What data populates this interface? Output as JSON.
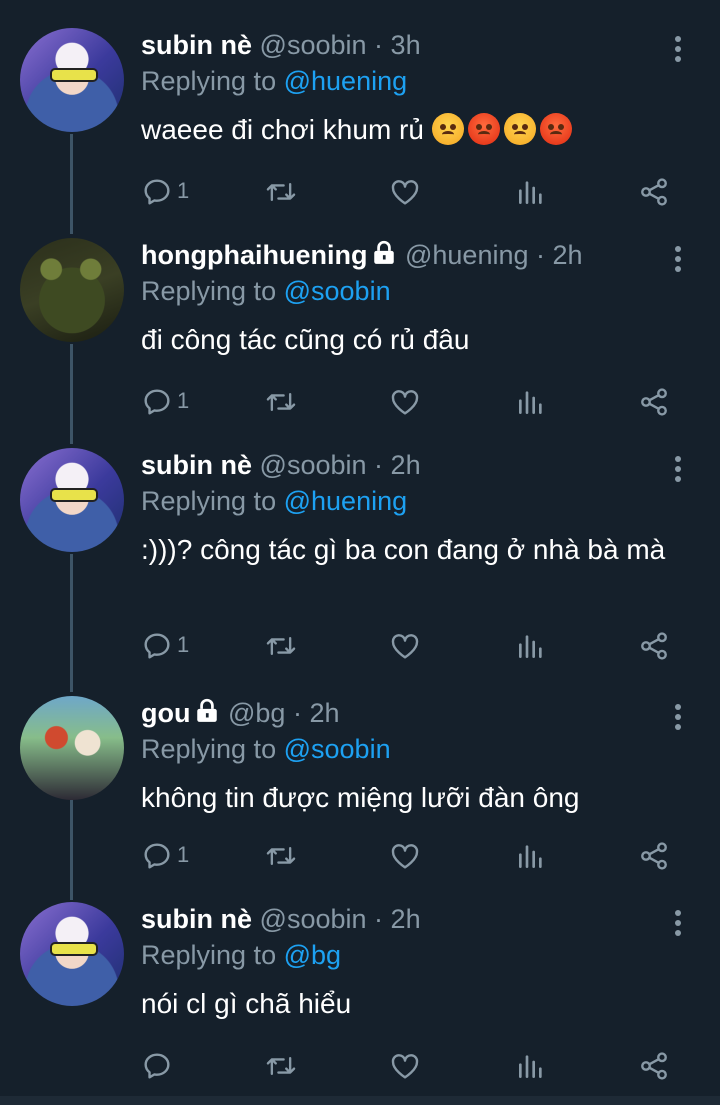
{
  "tweets": [
    {
      "name": "subin nè",
      "handle": "@soobin",
      "dot": "·",
      "time": "3h",
      "locked": false,
      "replying_prefix": "Replying to",
      "replying_to": "@huening",
      "text": "waeee đi chơi khum rủ",
      "emojis": [
        "angry-face",
        "pouting-face",
        "angry-face",
        "pouting-face"
      ],
      "reply_count": "1"
    },
    {
      "name": "hongphaihuening",
      "handle": "@huening",
      "dot": "·",
      "time": "2h",
      "locked": true,
      "replying_prefix": "Replying to",
      "replying_to": "@soobin",
      "text": "đi công tác cũng có rủ đâu",
      "reply_count": "1"
    },
    {
      "name": "subin nè",
      "handle": "@soobin",
      "dot": "·",
      "time": "2h",
      "locked": false,
      "replying_prefix": "Replying to",
      "replying_to": "@huening",
      "text": ":)))? công tác gì ba con đang ở nhà bà mà",
      "reply_count": "1"
    },
    {
      "name": "gou",
      "handle": "@bg",
      "dot": "·",
      "time": "2h",
      "locked": true,
      "replying_prefix": "Replying to",
      "replying_to": "@soobin",
      "text": "không tin được miệng lưỡi đàn ông",
      "reply_count": "1"
    },
    {
      "name": "subin nè",
      "handle": "@soobin",
      "dot": "·",
      "time": "2h",
      "locked": false,
      "replying_prefix": "Replying to",
      "replying_to": "@bg",
      "text": "nói cl gì chã hiểu",
      "reply_count": ""
    }
  ],
  "icons": {
    "reply": "comment-icon",
    "retweet": "retweet-icon",
    "like": "heart-icon",
    "stats": "analytics-icon",
    "share": "share-icon",
    "more": "more-vertical-icon",
    "lock": "lock-icon"
  },
  "colors": {
    "background": "#15202b",
    "secondary_text": "#8899a6",
    "mention": "#1da1f2",
    "thread_line": "#3d5466"
  }
}
